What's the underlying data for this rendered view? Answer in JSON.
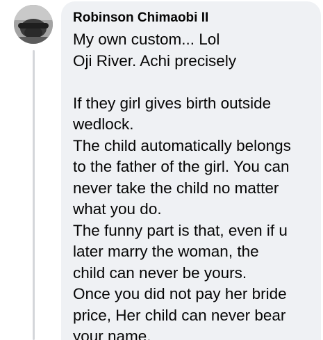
{
  "comment": {
    "author": "Robinson Chimaobi II",
    "avatar_icon": "profile-photo-avatar",
    "lines": [
      "My own custom... Lol",
      "Oji River. Achi precisely",
      "",
      "If they girl gives birth outside",
      "wedlock.",
      "The child automatically belongs",
      "to the father of the girl. You can",
      "never take the child no matter",
      "what you do.",
      "The funny part is that, even if u",
      "later marry the woman, the",
      "child can never be yours.",
      "Once you did not pay her bride",
      "price, Her child can never bear",
      "your name."
    ]
  },
  "colors": {
    "bubble_background": "#eff1f4",
    "text": "#050505",
    "thread_line": "#d4d6da"
  }
}
